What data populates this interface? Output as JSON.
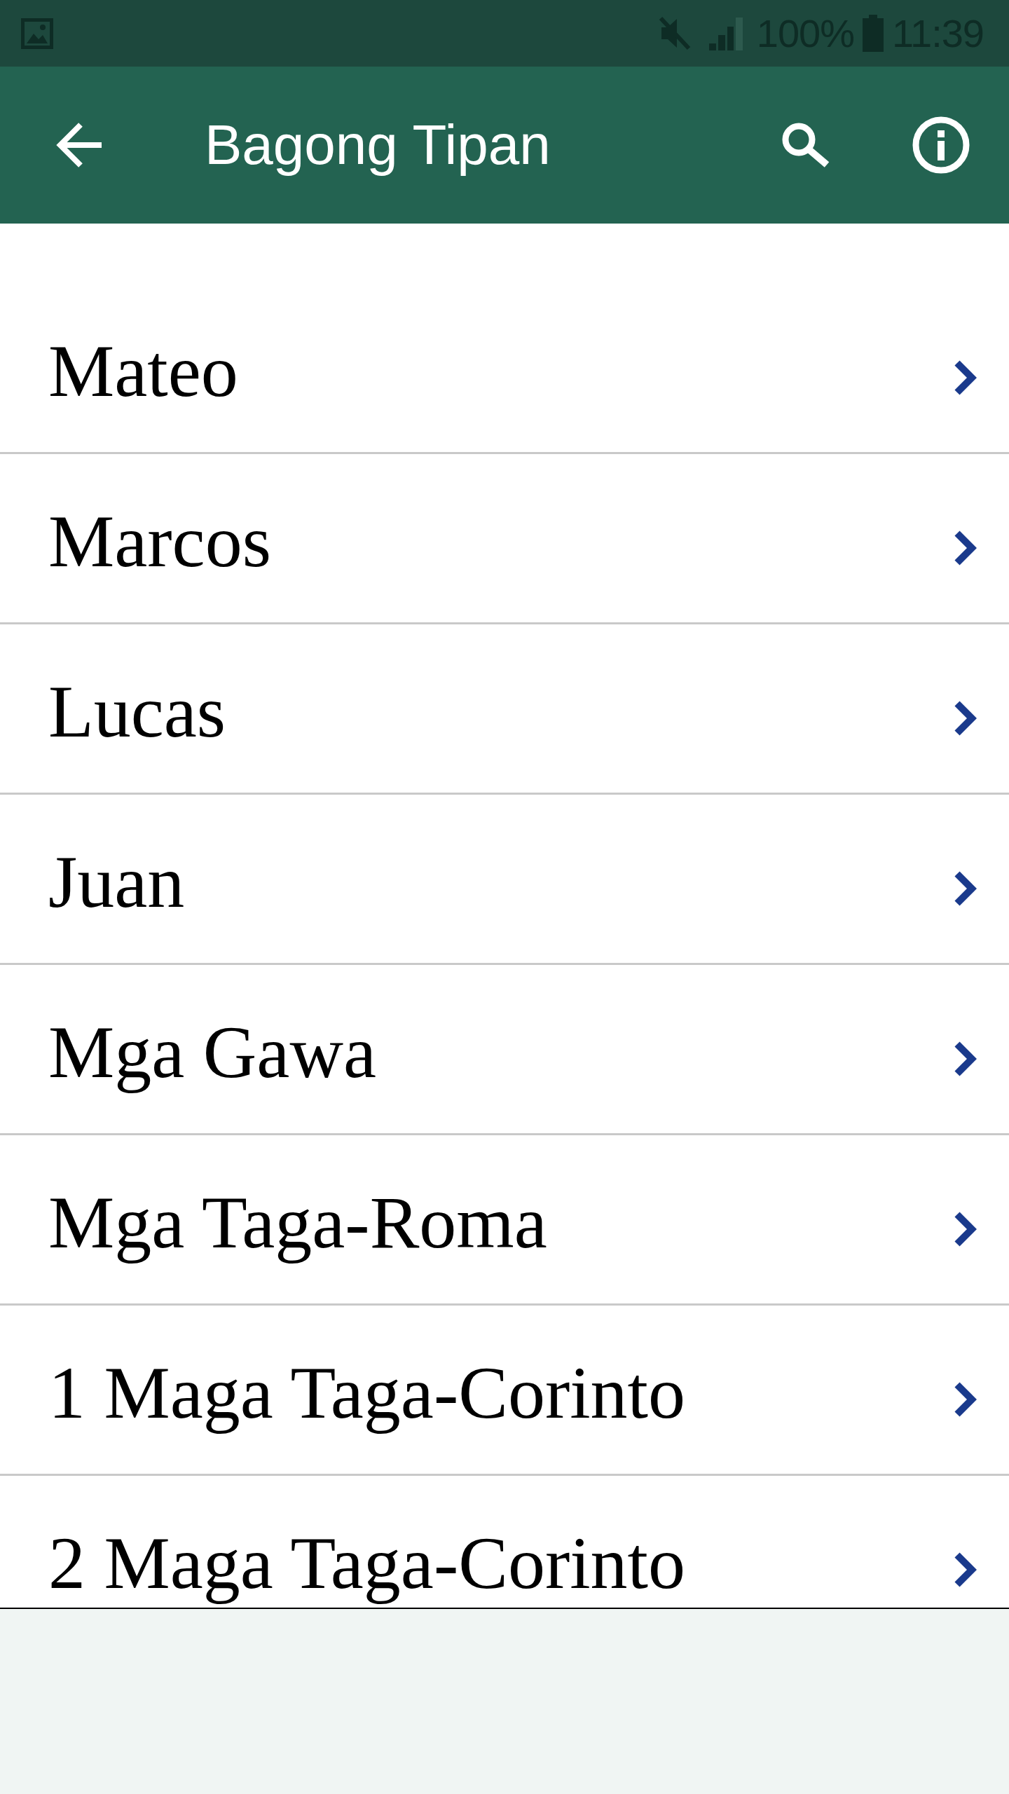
{
  "status_bar": {
    "battery": "100%",
    "time": "11:39"
  },
  "app_bar": {
    "title": "Bagong Tipan"
  },
  "books": [
    {
      "title": "Mateo"
    },
    {
      "title": "Marcos"
    },
    {
      "title": "Lucas"
    },
    {
      "title": "Juan"
    },
    {
      "title": "Mga Gawa"
    },
    {
      "title": "Mga Taga-Roma"
    },
    {
      "title": "1 Maga Taga-Corinto"
    },
    {
      "title": "2 Maga Taga-Corinto"
    }
  ]
}
